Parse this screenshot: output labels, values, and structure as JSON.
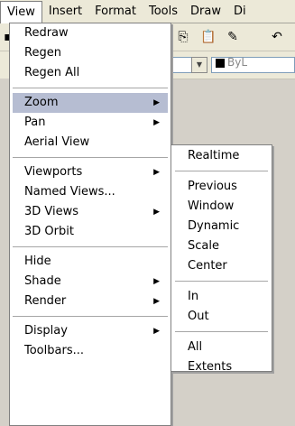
{
  "menubar": {
    "items": [
      {
        "label": "View"
      },
      {
        "label": "Insert"
      },
      {
        "label": "Format"
      },
      {
        "label": "Tools"
      },
      {
        "label": "Draw"
      },
      {
        "label": "Di"
      }
    ]
  },
  "toolbar": {
    "layer_text": "ByL"
  },
  "view_menu": {
    "groups": [
      [
        "Redraw",
        "Regen",
        "Regen All"
      ],
      [
        "Zoom",
        "Pan",
        "Aerial View"
      ],
      [
        "Viewports",
        "Named Views...",
        "3D Views",
        "3D Orbit"
      ],
      [
        "Hide",
        "Shade",
        "Render"
      ],
      [
        "Display",
        "Toolbars..."
      ]
    ],
    "submenu_arrow": "▶"
  },
  "zoom_submenu": {
    "groups": [
      [
        "Realtime"
      ],
      [
        "Previous",
        "Window",
        "Dynamic",
        "Scale",
        "Center"
      ],
      [
        "In",
        "Out"
      ],
      [
        "All",
        "Extents"
      ]
    ]
  },
  "colors": {
    "menu_highlight": "#b6bdd2",
    "menubar_bg": "#ece9d8"
  }
}
